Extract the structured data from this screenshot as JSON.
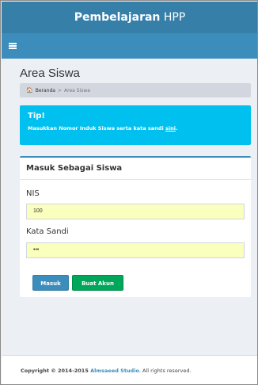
{
  "header": {
    "title_bold": "Pembelajaran",
    "title_light": " HPP"
  },
  "navbar": {
    "menu_icon": "hamburger-icon"
  },
  "page": {
    "title": "Area Siswa"
  },
  "breadcrumb": {
    "home_icon": "home-icon",
    "home": "Beranda",
    "separator": ">",
    "current": "Area Siswa"
  },
  "tip": {
    "title": "Tip!",
    "text": "Masukkan Nomor Induk Siswa serta kata sandi ",
    "link": "sini",
    "end": "."
  },
  "login_box": {
    "title": "Masuk Sebagai Siswa",
    "nis_label": "NIS",
    "nis_value": "100",
    "password_label": "Kata Sandi",
    "password_value": "•••",
    "login_button": "Masuk",
    "create_button": "Buat Akun"
  },
  "footer": {
    "copyright": "Copyright © 2014-2015 ",
    "studio": "Almsaeed Studio",
    "rights": ". All rights reserved."
  },
  "colors": {
    "header": "#367fa9",
    "navbar": "#3c8dbc",
    "tip": "#00c0ef",
    "primary_button": "#3c8dbc",
    "success_button": "#00a65a",
    "input_autofill": "#faffbd"
  }
}
